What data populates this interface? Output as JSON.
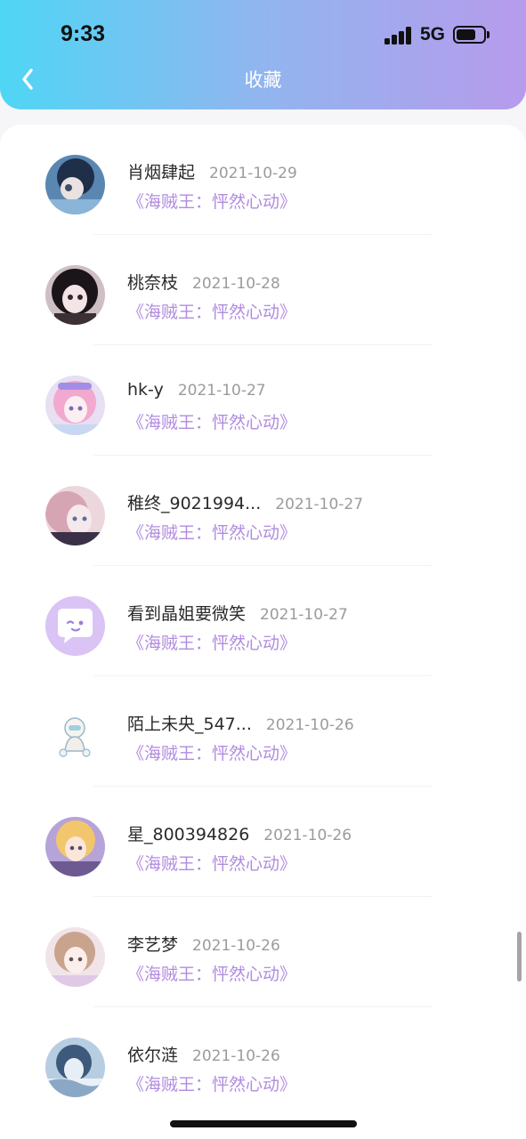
{
  "status_bar": {
    "time": "9:33",
    "network": "5G",
    "battery_level": 0.72
  },
  "header": {
    "title": "收藏",
    "back_icon": "chevron-left-icon"
  },
  "favorites": [
    {
      "username": "肖烟肆起",
      "date": "2021-10-29",
      "work": "《海贼王：怦然心动》"
    },
    {
      "username": "桃奈枝",
      "date": "2021-10-28",
      "work": "《海贼王：怦然心动》"
    },
    {
      "username": "hk-y",
      "date": "2021-10-27",
      "work": "《海贼王：怦然心动》"
    },
    {
      "username": "稚终_9021994...",
      "date": "2021-10-27",
      "work": "《海贼王：怦然心动》"
    },
    {
      "username": "看到晶姐要微笑",
      "date": "2021-10-27",
      "work": "《海贼王：怦然心动》"
    },
    {
      "username": "陌上未央_547...",
      "date": "2021-10-26",
      "work": "《海贼王：怦然心动》"
    },
    {
      "username": "星_800394826",
      "date": "2021-10-26",
      "work": "《海贼王：怦然心动》"
    },
    {
      "username": "李艺梦",
      "date": "2021-10-26",
      "work": "《海贼王：怦然心动》"
    },
    {
      "username": "依尔涟",
      "date": "2021-10-26",
      "work": "《海贼王：怦然心动》"
    }
  ],
  "colors": {
    "header_gradient": [
      "#4fd6f5",
      "#8fb6ef",
      "#b79bec"
    ],
    "work_title": "#b18cdf",
    "date": "#9b9b9b",
    "username": "#2a2a2a"
  }
}
